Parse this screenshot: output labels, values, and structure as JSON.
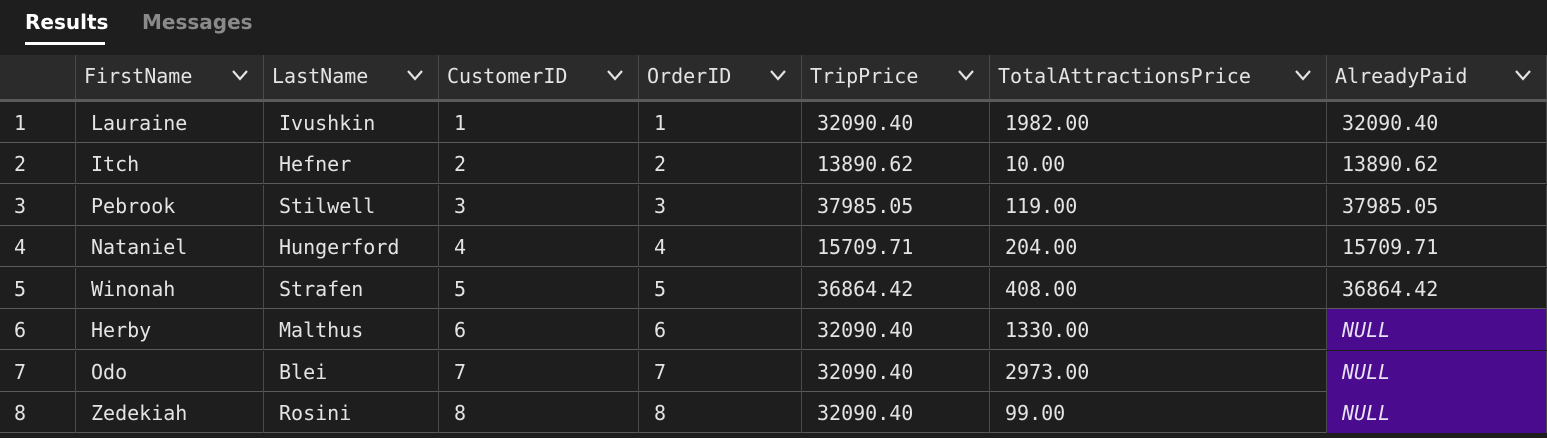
{
  "tabs": {
    "results": "Results",
    "messages": "Messages"
  },
  "columns": [
    "FirstName",
    "LastName",
    "CustomerID",
    "OrderID",
    "TripPrice",
    "TotalAttractionsPrice",
    "AlreadyPaid"
  ],
  "rows": [
    {
      "n": "1",
      "cells": [
        "Lauraine",
        "Ivushkin",
        "1",
        "1",
        "32090.40",
        "1982.00",
        "32090.40"
      ]
    },
    {
      "n": "2",
      "cells": [
        "Itch",
        "Hefner",
        "2",
        "2",
        "13890.62",
        "10.00",
        "13890.62"
      ]
    },
    {
      "n": "3",
      "cells": [
        "Pebrook",
        "Stilwell",
        "3",
        "3",
        "37985.05",
        "119.00",
        "37985.05"
      ]
    },
    {
      "n": "4",
      "cells": [
        "Nataniel",
        "Hungerford",
        "4",
        "4",
        "15709.71",
        "204.00",
        "15709.71"
      ]
    },
    {
      "n": "5",
      "cells": [
        "Winonah",
        "Strafen",
        "5",
        "5",
        "36864.42",
        "408.00",
        "36864.42"
      ]
    },
    {
      "n": "6",
      "cells": [
        "Herby",
        "Malthus",
        "6",
        "6",
        "32090.40",
        "1330.00",
        "NULL"
      ]
    },
    {
      "n": "7",
      "cells": [
        "Odo",
        "Blei",
        "7",
        "7",
        "32090.40",
        "2973.00",
        "NULL"
      ]
    },
    {
      "n": "8",
      "cells": [
        "Zedekiah",
        "Rosini",
        "8",
        "8",
        "32090.40",
        "99.00",
        "NULL"
      ]
    }
  ],
  "colors": {
    "background": "#1e1e1e",
    "header": "#2b2b2b",
    "null_highlight": "#4b0b8f"
  },
  "icons": {
    "column_menu": "chevron-down-icon"
  }
}
